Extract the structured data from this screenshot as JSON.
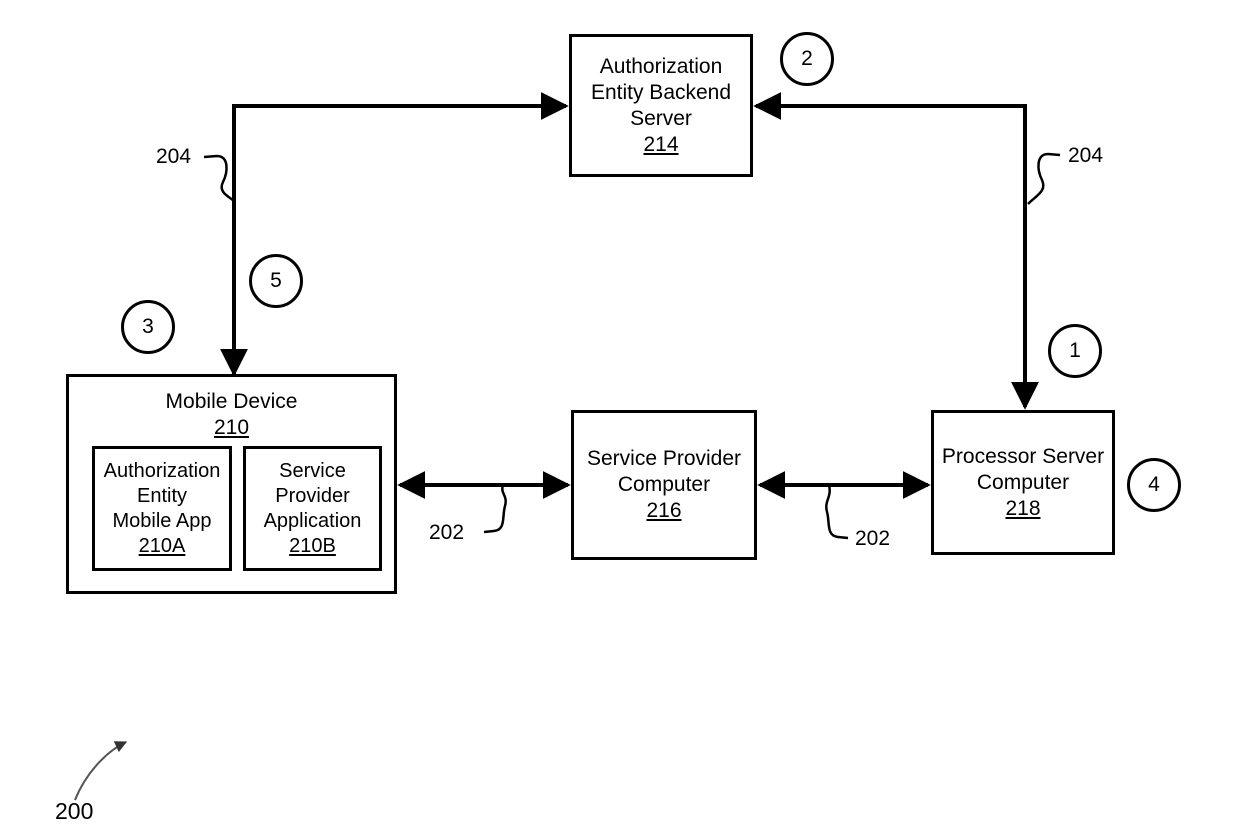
{
  "figure": {
    "label": "200",
    "name": "system-diagram"
  },
  "boxes": {
    "authorization_backend": {
      "title": "Authorization\nEntity Backend\nServer",
      "refnum": "214"
    },
    "mobile_device": {
      "title": "Mobile Device",
      "refnum": "210"
    },
    "authorization_app": {
      "title": "Authorization\nEntity\nMobile App",
      "refnum": "210A"
    },
    "service_provider_app": {
      "title": "Service\nProvider\nApplication",
      "refnum": "210B"
    },
    "service_provider_computer": {
      "title": "Service Provider\nComputer",
      "refnum": "216"
    },
    "processor_server_computer": {
      "title": "Processor Server\nComputer",
      "refnum": "218"
    }
  },
  "steps": [
    {
      "id": "step-1",
      "label": "1"
    },
    {
      "id": "step-2",
      "label": "2"
    },
    {
      "id": "step-3",
      "label": "3"
    },
    {
      "id": "step-4",
      "label": "4"
    },
    {
      "id": "step-5",
      "label": "5"
    }
  ],
  "connector_labels": {
    "network_202_left": "202",
    "network_202_right": "202",
    "network_204_left": "204",
    "network_204_right": "204"
  }
}
